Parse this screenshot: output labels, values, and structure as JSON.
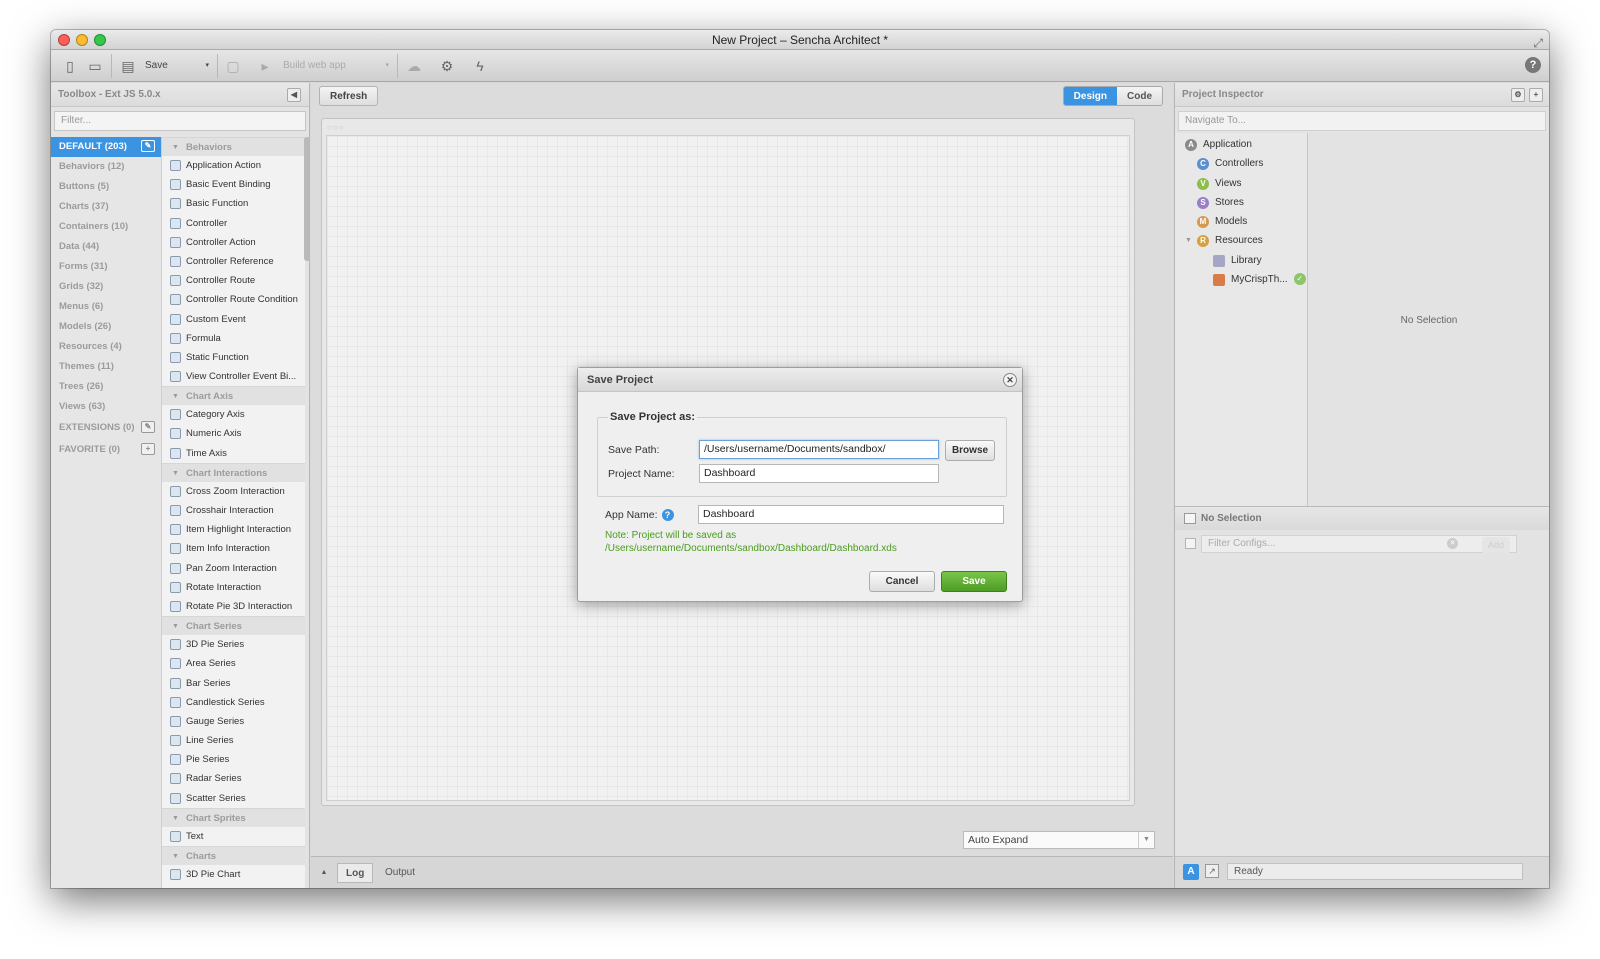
{
  "window": {
    "title": "New Project – Sencha Architect *"
  },
  "toolbar": {
    "save_label": "Save",
    "build_label": "Build web app"
  },
  "toolbox": {
    "title": "Toolbox - Ext JS 5.0.x",
    "filter_placeholder": "Filter...",
    "categories": [
      {
        "label": "DEFAULT (203)",
        "selected": true
      },
      {
        "label": "Behaviors (12)"
      },
      {
        "label": "Buttons (5)"
      },
      {
        "label": "Charts (37)"
      },
      {
        "label": "Containers (10)"
      },
      {
        "label": "Data (44)"
      },
      {
        "label": "Forms (31)"
      },
      {
        "label": "Grids (32)"
      },
      {
        "label": "Menus (6)"
      },
      {
        "label": "Models (26)"
      },
      {
        "label": "Resources (4)"
      },
      {
        "label": "Themes (11)"
      },
      {
        "label": "Trees (26)"
      },
      {
        "label": "Views (63)"
      }
    ],
    "extensions_label": "EXTENSIONS (0)",
    "favorite_label": "FAVORITE (0)",
    "groups": [
      {
        "name": "Behaviors",
        "items": [
          "Application Action",
          "Basic Event Binding",
          "Basic Function",
          "Controller",
          "Controller Action",
          "Controller Reference",
          "Controller Route",
          "Controller Route Condition",
          "Custom Event",
          "Formula",
          "Static Function",
          "View Controller Event Bi..."
        ]
      },
      {
        "name": "Chart Axis",
        "items": [
          "Category Axis",
          "Numeric Axis",
          "Time Axis"
        ]
      },
      {
        "name": "Chart Interactions",
        "items": [
          "Cross Zoom Interaction",
          "Crosshair Interaction",
          "Item Highlight Interaction",
          "Item Info Interaction",
          "Pan Zoom Interaction",
          "Rotate Interaction",
          "Rotate Pie 3D Interaction"
        ]
      },
      {
        "name": "Chart Series",
        "items": [
          "3D Pie Series",
          "Area Series",
          "Bar Series",
          "Candlestick Series",
          "Gauge Series",
          "Line Series",
          "Pie Series",
          "Radar Series",
          "Scatter Series"
        ]
      },
      {
        "name": "Chart Sprites",
        "items": [
          "Text"
        ]
      },
      {
        "name": "Charts",
        "items": [
          "3D Pie Chart"
        ]
      }
    ]
  },
  "center": {
    "refresh_label": "Refresh",
    "design_label": "Design",
    "code_label": "Code",
    "auto_expand": "Auto Expand",
    "log_tab": "Log",
    "output_tab": "Output"
  },
  "inspector": {
    "title": "Project Inspector",
    "navigate_placeholder": "Navigate To...",
    "tree": [
      {
        "label": "Application",
        "icon": "A",
        "color": "#8a8a8a"
      },
      {
        "label": "Controllers",
        "icon": "C",
        "color": "#5b8fd0"
      },
      {
        "label": "Views",
        "icon": "V",
        "color": "#8cbf4a"
      },
      {
        "label": "Stores",
        "icon": "S",
        "color": "#9a7fc4"
      },
      {
        "label": "Models",
        "icon": "M",
        "color": "#d49a52"
      },
      {
        "label": "Resources",
        "icon": "R",
        "color": "#d4a040"
      },
      {
        "label": "Library",
        "icon": "library-icon",
        "color": "#a5a5c5"
      },
      {
        "label": "MyCrispTh...",
        "icon": "theme-icon",
        "color": "#d87c4a"
      }
    ],
    "no_selection": "No Selection"
  },
  "config": {
    "title": "No Selection",
    "filter_placeholder": "Filter Configs...",
    "add_label": "Add"
  },
  "status": {
    "text": "Ready"
  },
  "dialog": {
    "title": "Save Project",
    "legend": "Save Project as:",
    "save_path_label": "Save Path:",
    "save_path_value": "/Users/username/Documents/sandbox/",
    "browse_label": "Browse",
    "project_name_label": "Project Name:",
    "project_name_value": "Dashboard",
    "app_name_label": "App Name:",
    "app_name_value": "Dashboard",
    "note_line1": "Note: Project will be saved as",
    "note_line2": "/Users/username/Documents/sandbox/Dashboard/Dashboard.xds",
    "cancel_label": "Cancel",
    "save_label": "Save"
  },
  "colors": {
    "accent": "#3a94e2",
    "save_green": "#5aa82e",
    "note_green": "#4a9c1f"
  }
}
